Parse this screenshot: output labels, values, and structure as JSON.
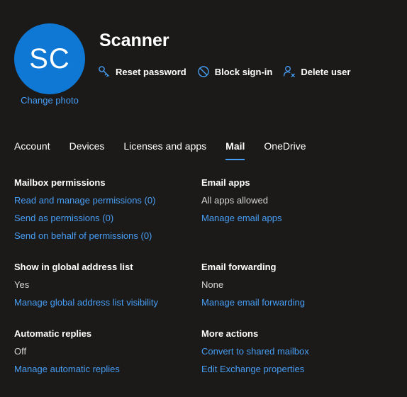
{
  "user": {
    "initials": "SC",
    "name": "Scanner",
    "change_photo": "Change photo"
  },
  "actions": {
    "reset_password": "Reset password",
    "block_signin": "Block sign-in",
    "delete_user": "Delete user"
  },
  "tabs": [
    {
      "label": "Account"
    },
    {
      "label": "Devices"
    },
    {
      "label": "Licenses and apps"
    },
    {
      "label": "Mail",
      "active": true
    },
    {
      "label": "OneDrive"
    }
  ],
  "mail": {
    "mailbox_permissions": {
      "title": "Mailbox permissions",
      "read_manage": "Read and manage permissions (0)",
      "send_as": "Send as permissions (0)",
      "send_on_behalf": "Send on behalf of permissions (0)"
    },
    "email_apps": {
      "title": "Email apps",
      "value": "All apps allowed",
      "manage": "Manage email apps"
    },
    "global_address_list": {
      "title": "Show in global address list",
      "value": "Yes",
      "manage": "Manage global address list visibility"
    },
    "email_forwarding": {
      "title": "Email forwarding",
      "value": "None",
      "manage": "Manage email forwarding"
    },
    "automatic_replies": {
      "title": "Automatic replies",
      "value": "Off",
      "manage": "Manage automatic replies"
    },
    "more_actions": {
      "title": "More actions",
      "convert": "Convert to shared mailbox",
      "edit_exchange": "Edit Exchange properties"
    }
  },
  "colors": {
    "background": "#1b1a19",
    "accent": "#479ef5",
    "avatar": "#0f78d4"
  }
}
